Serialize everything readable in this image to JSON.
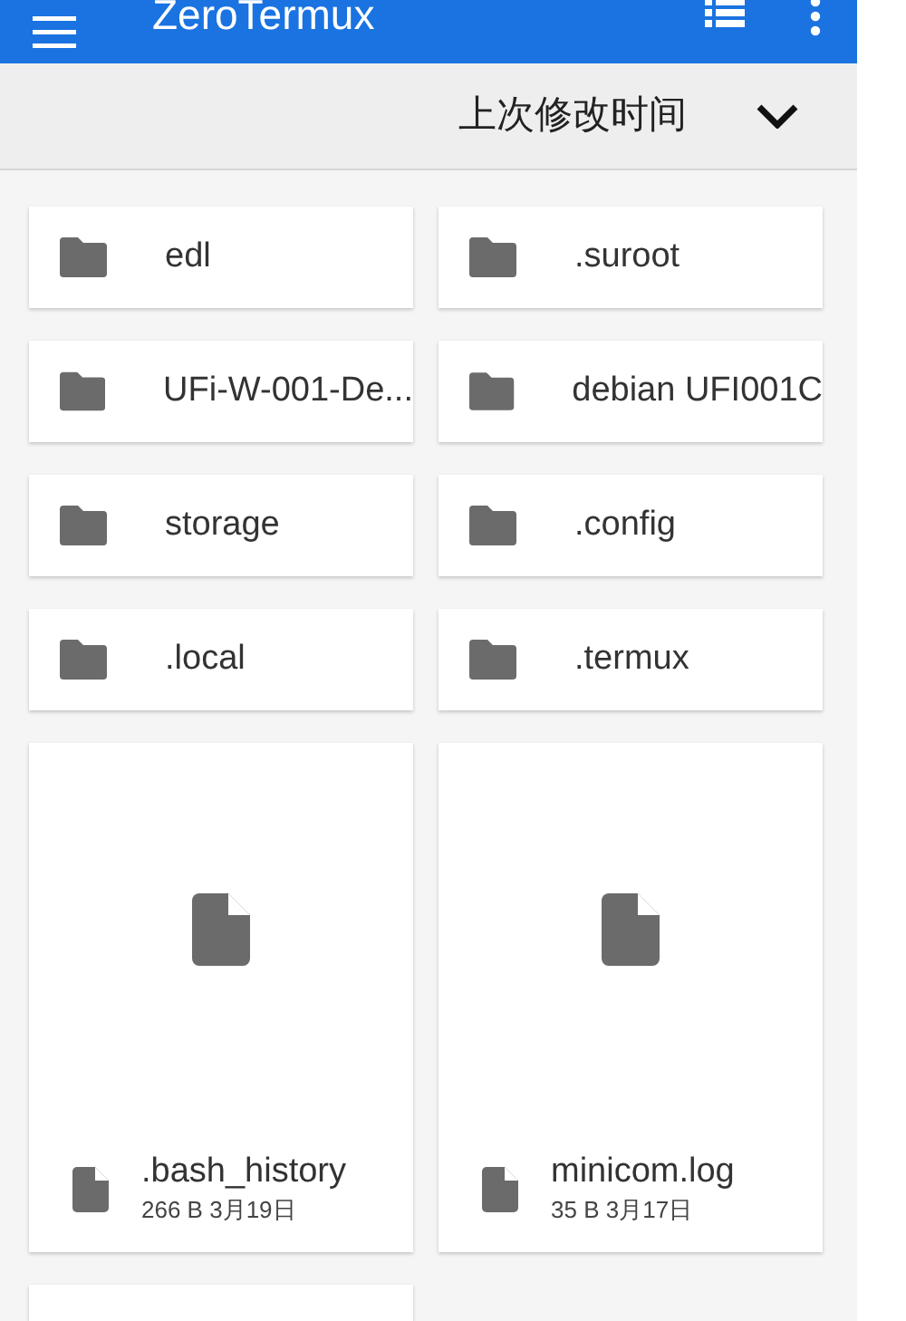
{
  "app_bar": {
    "title": "ZeroTermux"
  },
  "sort_bar": {
    "label": "上次修改时间"
  },
  "items": [
    {
      "kind": "folder",
      "name": "edl"
    },
    {
      "kind": "folder",
      "name": ".suroot"
    },
    {
      "kind": "folder",
      "name": "UFi-W-001-De..."
    },
    {
      "kind": "folder",
      "name": "debian UFI001C"
    },
    {
      "kind": "folder",
      "name": "storage"
    },
    {
      "kind": "folder",
      "name": ".config"
    },
    {
      "kind": "folder",
      "name": ".local"
    },
    {
      "kind": "folder",
      "name": ".termux"
    },
    {
      "kind": "file",
      "name": ".bash_history",
      "meta": "266 B 3月19日"
    },
    {
      "kind": "file",
      "name": "minicom.log",
      "meta": "35 B 3月17日"
    }
  ]
}
